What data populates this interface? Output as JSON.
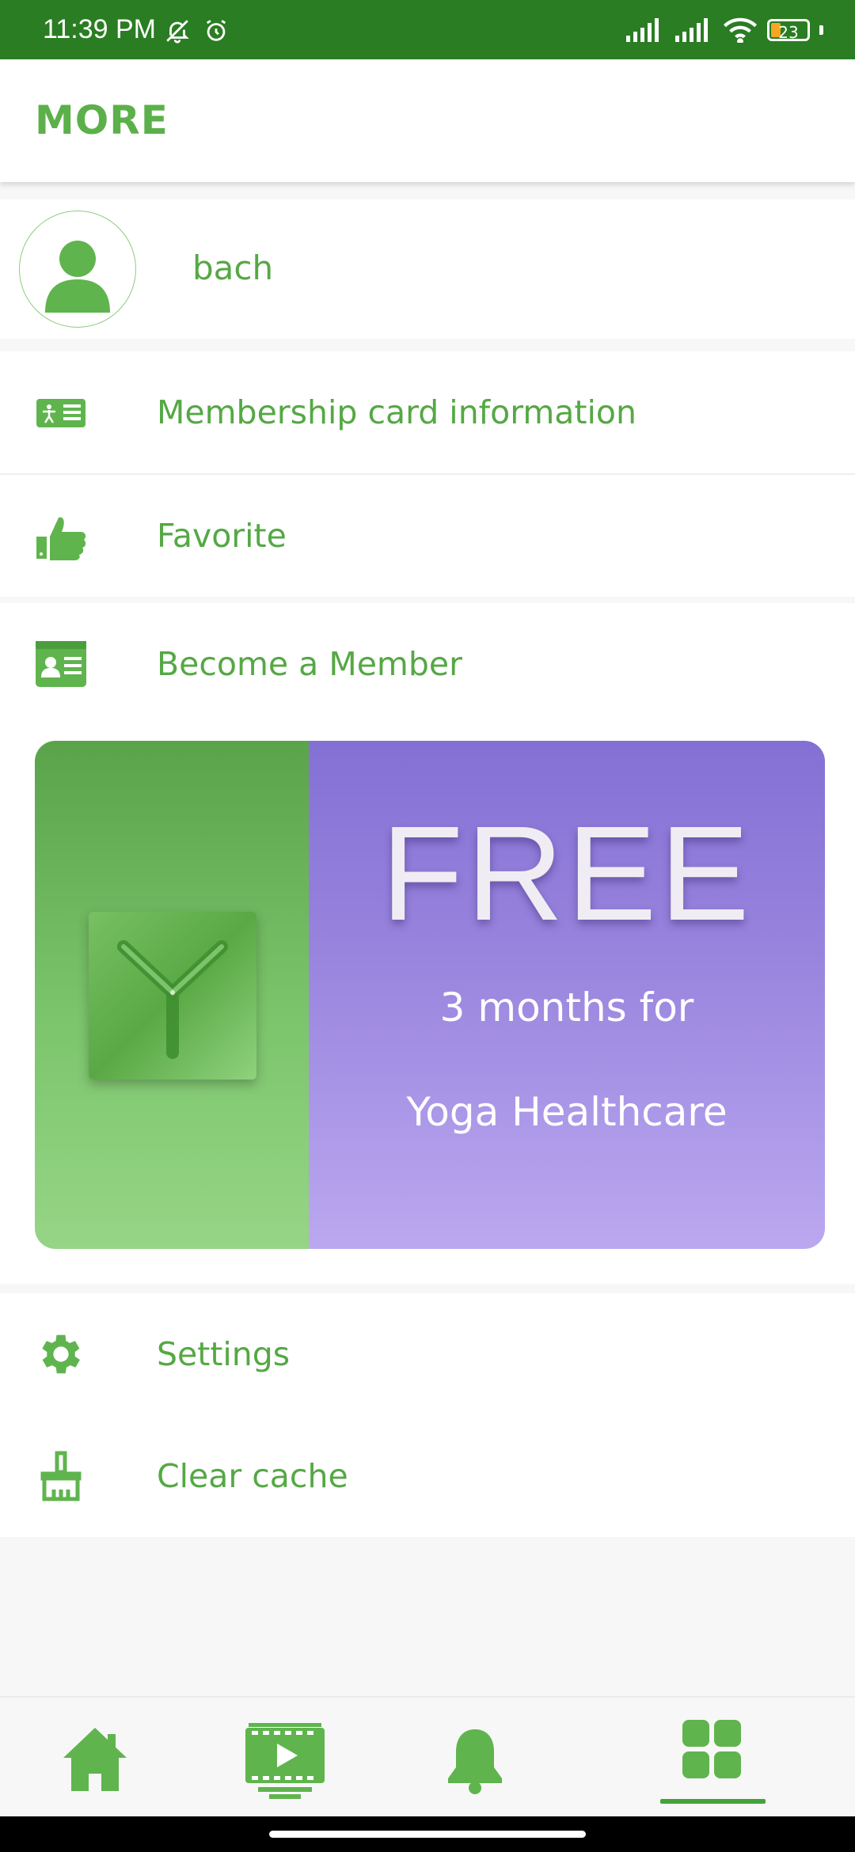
{
  "status_bar": {
    "time": "11:39 PM",
    "battery": "23",
    "icons": [
      "bell-off-icon",
      "alarm-icon",
      "signal-icon",
      "signal-icon",
      "wifi-icon",
      "battery-icon"
    ]
  },
  "header": {
    "title": "MORE"
  },
  "profile": {
    "name": "bach",
    "avatar_icon": "user-avatar-icon"
  },
  "menu": {
    "membership_card": {
      "label": "Membership card information",
      "icon": "id-card-icon"
    },
    "favorite": {
      "label": "Favorite",
      "icon": "thumbs-up-icon"
    },
    "become_member": {
      "label": "Become a Member",
      "icon": "contact-card-icon"
    },
    "settings": {
      "label": "Settings",
      "icon": "gear-icon"
    },
    "clear_cache": {
      "label": "Clear cache",
      "icon": "broom-icon"
    }
  },
  "promo": {
    "headline": "FREE",
    "line1": "3 months for",
    "line2": "Yoga Healthcare",
    "logo_icon": "yoga-y-logo"
  },
  "bottom_nav": {
    "items": [
      {
        "name": "home",
        "icon": "home-icon",
        "selected": false
      },
      {
        "name": "videos",
        "icon": "video-player-icon",
        "selected": false
      },
      {
        "name": "notifications",
        "icon": "bell-icon",
        "selected": false
      },
      {
        "name": "more",
        "icon": "grid-icon",
        "selected": true
      }
    ]
  },
  "colors": {
    "status_bar": "#2a7d22",
    "accent_green": "#5cb04a",
    "promo_purple": "#8470d4"
  }
}
